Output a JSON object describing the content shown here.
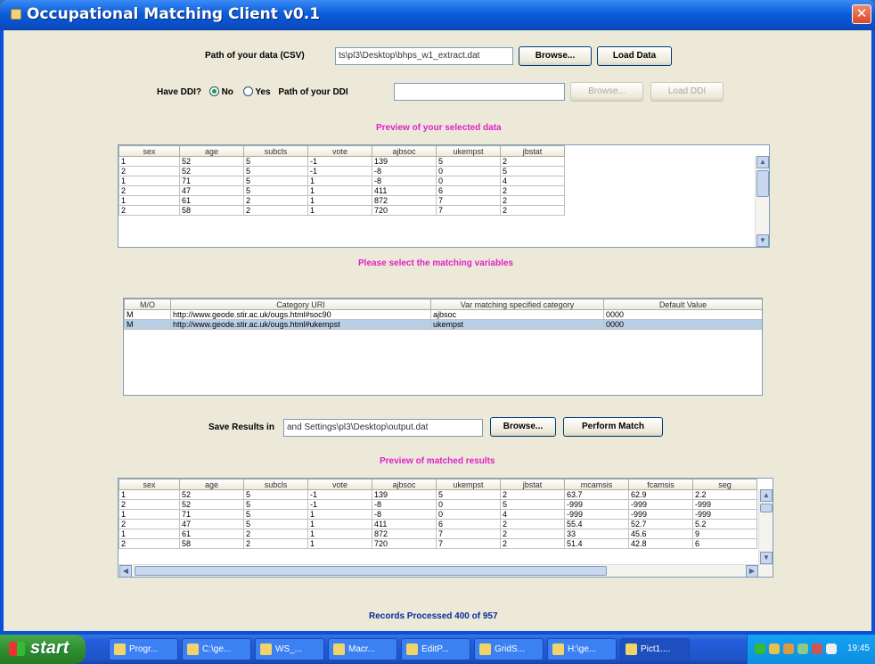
{
  "window": {
    "title": "Occupational Matching Client v0.1",
    "close_glyph": "✕"
  },
  "data_path": {
    "label": "Path of your data (CSV)",
    "value": "ts\\pl3\\Desktop\\bhps_w1_extract.dat",
    "browse_label": "Browse...",
    "load_label": "Load Data"
  },
  "ddi": {
    "question": "Have DDI?",
    "no_label": "No",
    "yes_label": "Yes",
    "selected": "No",
    "path_label": "Path of your DDI",
    "path_value": "",
    "browse_label": "Browse...",
    "load_label": "Load DDI"
  },
  "preview": {
    "heading": "Preview of your selected data",
    "columns": [
      "sex",
      "age",
      "subcls",
      "vote",
      "ajbsoc",
      "ukempst",
      "jbstat"
    ],
    "rows": [
      [
        "1",
        "52",
        "5",
        "-1",
        "139",
        "5",
        "2"
      ],
      [
        "2",
        "52",
        "5",
        "-1",
        "-8",
        "0",
        "5"
      ],
      [
        "1",
        "71",
        "5",
        "1",
        "-8",
        "0",
        "4"
      ],
      [
        "2",
        "47",
        "5",
        "1",
        "411",
        "6",
        "2"
      ],
      [
        "1",
        "61",
        "2",
        "1",
        "872",
        "7",
        "2"
      ],
      [
        "2",
        "58",
        "2",
        "1",
        "720",
        "7",
        "2"
      ]
    ]
  },
  "matching": {
    "heading": "Please select the matching variables",
    "columns": [
      "M/O",
      "Category URI",
      "Var matching specified category",
      "Default Value"
    ],
    "rows": [
      [
        "M",
        "http://www.geode.stir.ac.uk/ougs.html#soc90",
        "ajbsoc",
        "0000"
      ],
      [
        "M",
        "http://www.geode.stir.ac.uk/ougs.html#ukempst",
        "ukempst",
        "0000"
      ]
    ]
  },
  "save": {
    "label": "Save Results in",
    "value": "and Settings\\pl3\\Desktop\\output.dat",
    "browse_label": "Browse...",
    "perform_label": "Perform Match"
  },
  "results": {
    "heading": "Preview of matched results",
    "columns": [
      "sex",
      "age",
      "subcls",
      "vote",
      "ajbsoc",
      "ukempst",
      "jbstat",
      "mcamsis",
      "fcamsis",
      "seg"
    ],
    "rows": [
      [
        "1",
        "52",
        "5",
        "-1",
        "139",
        "5",
        "2",
        "63.7",
        "62.9",
        "2.2"
      ],
      [
        "2",
        "52",
        "5",
        "-1",
        "-8",
        "0",
        "5",
        "-999",
        "-999",
        "-999"
      ],
      [
        "1",
        "71",
        "5",
        "1",
        "-8",
        "0",
        "4",
        "-999",
        "-999",
        "-999"
      ],
      [
        "2",
        "47",
        "5",
        "1",
        "411",
        "6",
        "2",
        "55.4",
        "52.7",
        "5.2"
      ],
      [
        "1",
        "61",
        "2",
        "1",
        "872",
        "7",
        "2",
        "33",
        "45.6",
        "9"
      ],
      [
        "2",
        "58",
        "2",
        "1",
        "720",
        "7",
        "2",
        "51.4",
        "42.8",
        "6"
      ]
    ]
  },
  "status": "Records Processed 400 of 957",
  "taskbar": {
    "start_label": "start",
    "tasks": [
      "Progr...",
      "C:\\ge...",
      "WS_...",
      "Macr...",
      "EditP...",
      "GridS...",
      "H:\\ge...",
      "Pict1...."
    ],
    "clock": "19:45"
  },
  "icons": {
    "window": "app-icon",
    "close": "close-icon",
    "scroll_up": "scroll-up-icon",
    "scroll_down": "scroll-down-icon"
  }
}
